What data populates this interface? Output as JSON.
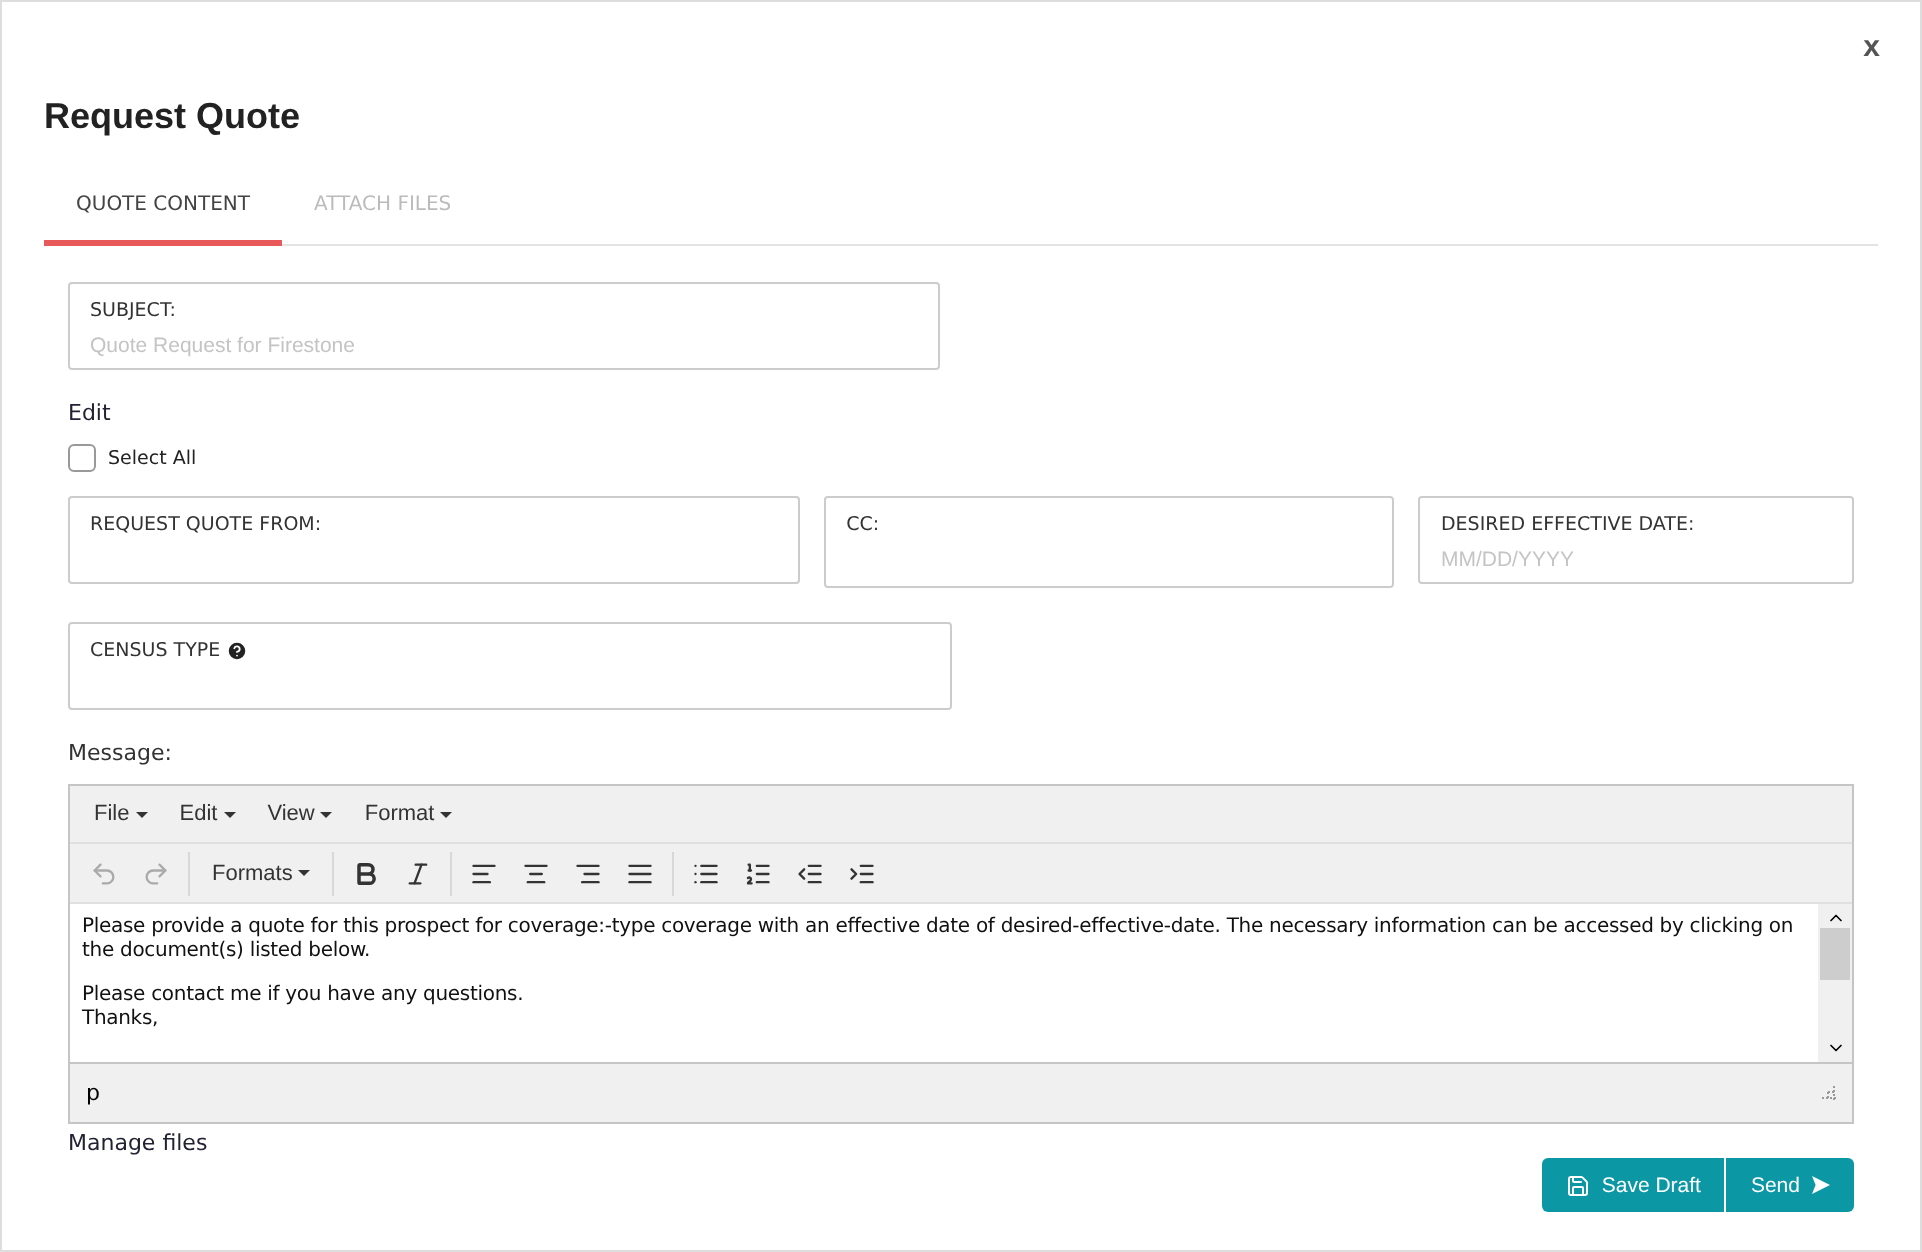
{
  "dialog": {
    "title": "Request Quote",
    "close": "x"
  },
  "tabs": [
    {
      "label": "QUOTE CONTENT",
      "selected": true
    },
    {
      "label": "ATTACH FILES",
      "selected": false
    }
  ],
  "subject": {
    "label": "SUBJECT:",
    "placeholder": "Quote Request for Firestone"
  },
  "edit_link": "Edit",
  "select_all": {
    "label": "Select All",
    "checked": false
  },
  "fields": [
    {
      "label": "REQUEST QUOTE FROM:"
    },
    {
      "label": "CC:"
    },
    {
      "label": "DESIRED EFFECTIVE DATE:",
      "placeholder": "MM/DD/YYYY"
    }
  ],
  "census": {
    "label": "CENSUS TYPE",
    "help": true
  },
  "message": {
    "label": "Message:",
    "menus": [
      "File",
      "Edit",
      "View",
      "Format"
    ],
    "formats": "Formats",
    "paragraphs": [
      "Please provide a quote for this prospect for coverage:-type coverage with an effective date of desired-effective-date. The necessary information can be accessed by clicking on the document(s) listed below.",
      "Please contact me if you have any questions.\nThanks,"
    ],
    "status_path": "p"
  },
  "manage_files": "Manage files",
  "buttons": [
    {
      "kind": "save",
      "label": "Save Draft"
    },
    {
      "kind": "send",
      "label": "Send"
    }
  ]
}
